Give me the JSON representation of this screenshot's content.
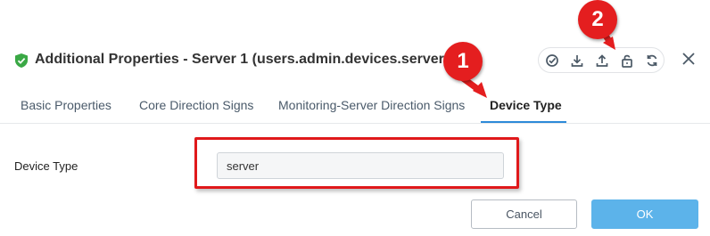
{
  "dialog": {
    "title": "Additional Properties - Server 1 (users.admin.devices.server1)"
  },
  "toolbar": {
    "icons": [
      "check-circle-icon",
      "download-icon",
      "upload-icon",
      "unlock-icon",
      "sync-icon"
    ]
  },
  "tabs": [
    {
      "label": "Basic Properties",
      "active": false
    },
    {
      "label": "Core Direction Signs",
      "active": false
    },
    {
      "label": "Monitoring-Server Direction Signs",
      "active": false
    },
    {
      "label": "Device Type",
      "active": true
    }
  ],
  "form": {
    "device_type_label": "Device Type",
    "device_type_value": "server"
  },
  "buttons": {
    "cancel": "Cancel",
    "ok": "OK"
  },
  "annotations": {
    "marker_1": "1",
    "marker_2": "2",
    "color": "#e41e1f"
  },
  "colors": {
    "accent": "#2d8ad8",
    "ok_button": "#5cb3ea",
    "check_green": "#3aa845"
  }
}
